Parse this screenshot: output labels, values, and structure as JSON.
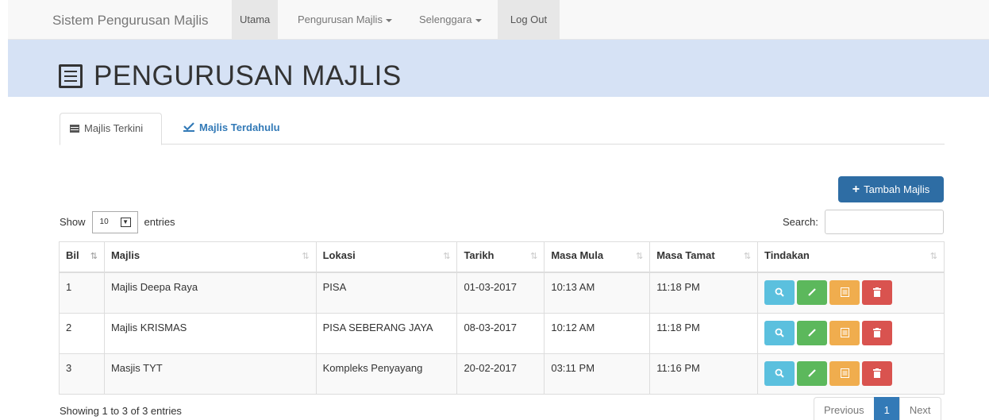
{
  "navbar": {
    "brand": "Sistem Pengurusan Majlis",
    "items": [
      {
        "label": "Utama"
      },
      {
        "label": "Pengurusan Majlis"
      },
      {
        "label": "Selenggara"
      },
      {
        "label": "Log Out"
      }
    ]
  },
  "header": {
    "title": "PENGURUSAN MAJLIS",
    "icon": "list-alt-icon"
  },
  "tabs": [
    {
      "label": "Majlis Terkini",
      "icon": "calendar-icon"
    },
    {
      "label": "Majlis Terdahulu",
      "icon": "check-icon"
    }
  ],
  "add_button": {
    "label": "Tambah Majlis"
  },
  "table_controls": {
    "show_label": "Show",
    "entries_value": "10",
    "entries_label": "entries",
    "search_label": "Search:",
    "search_value": ""
  },
  "table": {
    "columns": [
      "Bil",
      "Majlis",
      "Lokasi",
      "Tarikh",
      "Masa Mula",
      "Masa Tamat",
      "Tindakan"
    ],
    "rows": [
      {
        "bil": "1",
        "majlis": "Majlis Deepa Raya",
        "lokasi": "PISA",
        "tarikh": "01-03-2017",
        "mula": "10:13 AM",
        "tamat": "11:18 PM"
      },
      {
        "bil": "2",
        "majlis": "Majlis KRISMAS",
        "lokasi": "PISA SEBERANG JAYA",
        "tarikh": "08-03-2017",
        "mula": "10:12 AM",
        "tamat": "11:18 PM"
      },
      {
        "bil": "3",
        "majlis": "Masjis TYT",
        "lokasi": "Kompleks Penyayang",
        "tarikh": "20-02-2017",
        "mula": "03:11 PM",
        "tamat": "11:16 PM"
      }
    ]
  },
  "footer": {
    "info": "Showing 1 to 3 of 3 entries",
    "pagination": {
      "previous": "Previous",
      "current": "1",
      "next": "Next"
    }
  },
  "colors": {
    "primary": "#337ab7",
    "banner": "#d6e2f5",
    "view": "#5bc0de",
    "edit": "#5cb85c",
    "doc": "#f0ad4e",
    "delete": "#d9534f"
  }
}
